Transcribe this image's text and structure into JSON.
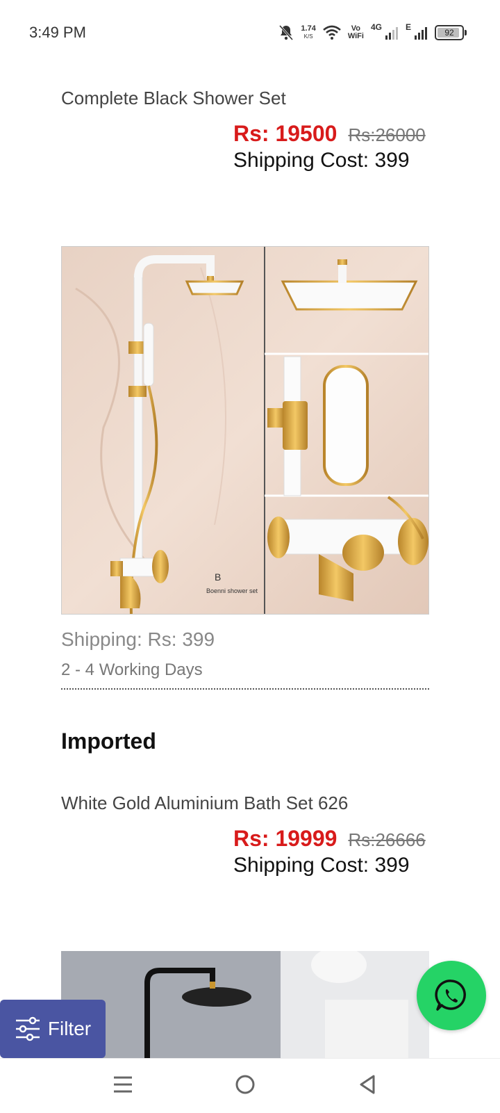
{
  "status_bar": {
    "time": "3:49 PM",
    "speed_value": "1.74",
    "speed_unit": "K/S",
    "volte_top": "Vo",
    "volte_bottom": "WiFi",
    "net_4g": "4G",
    "net_e": "E",
    "battery": "92",
    "battery_level": 0.92
  },
  "products": [
    {
      "title": "Complete Black Shower Set",
      "price": "Rs: 19500",
      "old_price": "Rs:26000",
      "shipping_cost": "Shipping Cost: 399"
    },
    {
      "title": "White Gold Aluminium Bath Set 626",
      "price": "Rs: 19999",
      "old_price": "Rs:26666",
      "shipping_cost": "Shipping Cost: 399"
    }
  ],
  "detail": {
    "shipping": "Shipping: Rs: 399",
    "delivery": "2 - 4 Working Days",
    "image_tag_letter": "B",
    "image_tag_caption": "Boenni shower set"
  },
  "section": {
    "heading": "Imported"
  },
  "filter": {
    "label": "Filter"
  },
  "colors": {
    "price": "#d81b1b",
    "filter_bg": "#4a55a2",
    "whatsapp": "#25d366"
  }
}
